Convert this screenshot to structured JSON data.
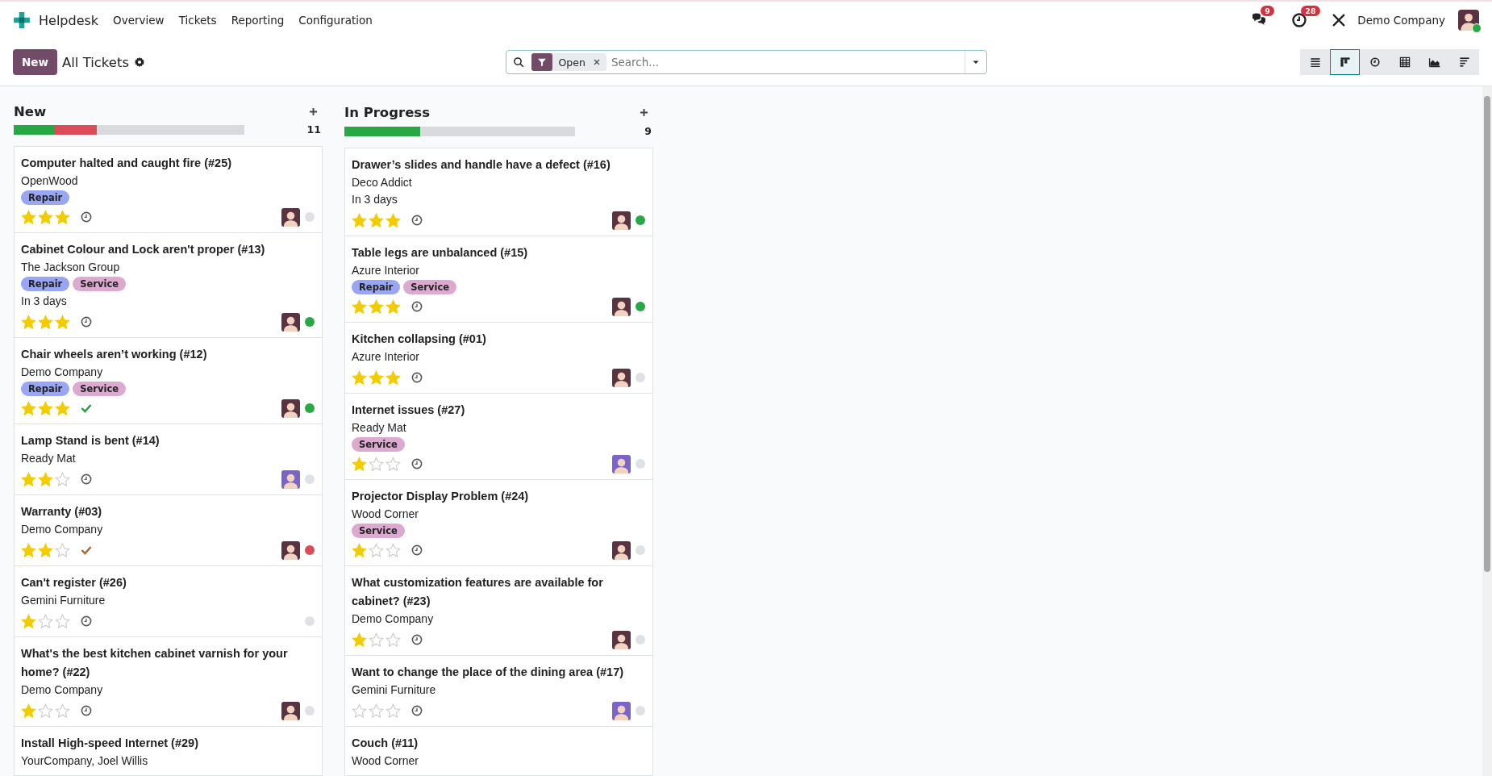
{
  "navbar": {
    "app_name": "Helpdesk",
    "menu": [
      "Overview",
      "Tickets",
      "Reporting",
      "Configuration"
    ],
    "messages_badge": "9",
    "activities_badge": "28",
    "company": "Demo Company",
    "user_online": true
  },
  "control_panel": {
    "new_button": "New",
    "breadcrumb": "All Tickets",
    "search": {
      "facets": [
        {
          "label": "Open"
        }
      ],
      "placeholder": "Search..."
    },
    "views": [
      {
        "kind": "list",
        "selected": false
      },
      {
        "kind": "kanban",
        "selected": true
      },
      {
        "kind": "activity",
        "selected": false
      },
      {
        "kind": "pivot",
        "selected": false
      },
      {
        "kind": "graph",
        "selected": false
      },
      {
        "kind": "gantt",
        "selected": false
      }
    ]
  },
  "columns": [
    {
      "title": "New",
      "count": "11",
      "progress": [
        {
          "color": "#28a745",
          "level": 0.18
        },
        {
          "color": "#dc4c58",
          "level": 0.18
        }
      ],
      "cards": [
        {
          "title": "Computer halted and caught fire (#25)",
          "customer": "OpenWood",
          "tags": [
            {
              "label": "Repair",
              "color": "#98a6f3"
            }
          ],
          "stars": 3,
          "activity": {
            "kind": "clock"
          },
          "avatar": {
            "color": "#5a3342"
          },
          "status": {
            "color": "#dee2e6"
          }
        },
        {
          "title": "Cabinet Colour and Lock aren't proper (#13)",
          "customer": "The Jackson Group",
          "tags": [
            {
              "label": "Repair",
              "color": "#98a6f3"
            },
            {
              "label": "Service",
              "color": "#dcaad0"
            }
          ],
          "deadline": "In 3 days",
          "stars": 3,
          "activity": {
            "kind": "clock"
          },
          "avatar": {
            "color": "#5a3342"
          },
          "status": {
            "color": "#28a745"
          }
        },
        {
          "title": "Chair wheels aren’t working (#12)",
          "customer": "Demo Company",
          "tags": [
            {
              "label": "Repair",
              "color": "#98a6f3"
            },
            {
              "label": "Service",
              "color": "#dcaad0"
            }
          ],
          "stars": 3,
          "activity": {
            "kind": "done"
          },
          "avatar": {
            "color": "#5a3342"
          },
          "status": {
            "color": "#28a745"
          }
        },
        {
          "title": "Lamp Stand is bent (#14)",
          "customer": "Ready Mat",
          "stars": 2,
          "activity": {
            "kind": "clock"
          },
          "avatar": {
            "color": "#7a64c8"
          },
          "status": {
            "color": "#dee2e6"
          }
        },
        {
          "title": "Warranty (#03)",
          "customer": "Demo Company",
          "stars": 2,
          "activity": {
            "kind": "overdue-done"
          },
          "avatar": {
            "color": "#5a3342"
          },
          "status": {
            "color": "#dc4c58"
          }
        },
        {
          "title": "Can't register (#26)",
          "customer": "Gemini Furniture",
          "stars": 1,
          "activity": {
            "kind": "clock"
          },
          "status": {
            "color": "#dee2e6"
          }
        },
        {
          "title": "What's the best kitchen cabinet varnish for your home? (#22)",
          "customer": "Demo Company",
          "stars": 1,
          "activity": {
            "kind": "clock"
          },
          "avatar": {
            "color": "#5a3342"
          },
          "status": {
            "color": "#dee2e6"
          }
        },
        {
          "title": "Install High-speed Internet (#29)",
          "customer": "YourCompany, Joel Willis"
        }
      ]
    },
    {
      "title": "In Progress",
      "count": "9",
      "progress": [
        {
          "color": "#28a745",
          "level": 0.33
        }
      ],
      "cards": [
        {
          "title": "Drawer’s slides and handle have a defect (#16)",
          "customer": "Deco Addict",
          "deadline": "In 3 days",
          "stars": 3,
          "activity": {
            "kind": "clock"
          },
          "avatar": {
            "color": "#5a3342"
          },
          "status": {
            "color": "#28a745"
          }
        },
        {
          "title": "Table legs are unbalanced (#15)",
          "customer": "Azure Interior",
          "tags": [
            {
              "label": "Repair",
              "color": "#98a6f3"
            },
            {
              "label": "Service",
              "color": "#dcaad0"
            }
          ],
          "stars": 3,
          "activity": {
            "kind": "clock"
          },
          "avatar": {
            "color": "#5a3342"
          },
          "status": {
            "color": "#28a745"
          }
        },
        {
          "title": "Kitchen collapsing (#01)",
          "customer": "Azure Interior",
          "stars": 3,
          "activity": {
            "kind": "clock"
          },
          "avatar": {
            "color": "#5a3342"
          },
          "status": {
            "color": "#dee2e6"
          }
        },
        {
          "title": "Internet issues (#27)",
          "customer": "Ready Mat",
          "tags": [
            {
              "label": "Service",
              "color": "#dcaad0"
            }
          ],
          "stars": 1,
          "activity": {
            "kind": "clock"
          },
          "avatar": {
            "color": "#7a64c8"
          },
          "status": {
            "color": "#dee2e6"
          }
        },
        {
          "title": "Projector Display Problem (#24)",
          "customer": "Wood Corner",
          "tags": [
            {
              "label": "Service",
              "color": "#dcaad0"
            }
          ],
          "stars": 1,
          "activity": {
            "kind": "clock"
          },
          "avatar": {
            "color": "#5a3342"
          },
          "status": {
            "color": "#dee2e6"
          }
        },
        {
          "title": "What customization features are available for cabinet? (#23)",
          "customer": "Demo Company",
          "stars": 1,
          "activity": {
            "kind": "clock"
          },
          "avatar": {
            "color": "#5a3342"
          },
          "status": {
            "color": "#dee2e6"
          }
        },
        {
          "title": "Want to change the place of the dining area (#17)",
          "customer": "Gemini Furniture",
          "stars": 0,
          "activity": {
            "kind": "clock"
          },
          "avatar": {
            "color": "#7a64c8"
          },
          "status": {
            "color": "#dee2e6"
          }
        },
        {
          "title": "Couch (#11)",
          "customer": "Wood Corner"
        }
      ]
    }
  ]
}
